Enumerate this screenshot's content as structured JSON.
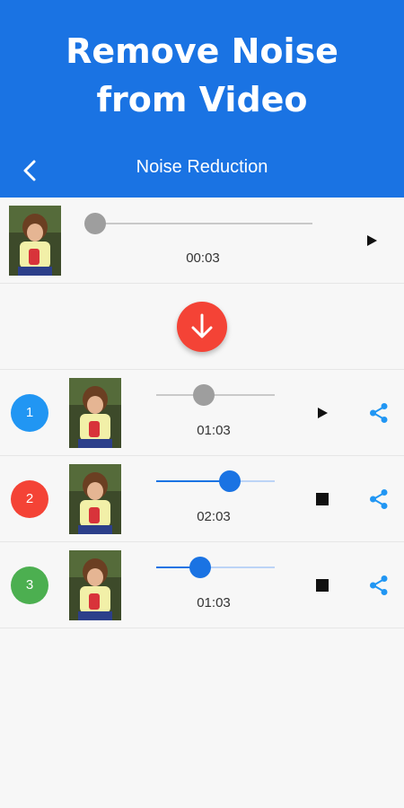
{
  "promo": {
    "line1": "Remove Noise",
    "line2": "from Video"
  },
  "toolbar": {
    "title": "Noise Reduction",
    "back_icon": "chevron-left-icon"
  },
  "colors": {
    "primary": "#1a73e3",
    "accent_red": "#f44336",
    "badge_blue": "#2196f3",
    "badge_red": "#f44336",
    "badge_green": "#4caf50"
  },
  "original": {
    "time": "00:03",
    "progress": 0.03,
    "control": "play-icon"
  },
  "download": {
    "icon": "arrow-down-icon"
  },
  "results": [
    {
      "number": "1",
      "time": "01:03",
      "progress": 0.4,
      "control": "play-icon",
      "share_icon": "share-icon"
    },
    {
      "number": "2",
      "time": "02:03",
      "progress": 0.62,
      "control": "stop-icon",
      "share_icon": "share-icon"
    },
    {
      "number": "3",
      "time": "01:03",
      "progress": 0.37,
      "control": "stop-icon",
      "share_icon": "share-icon"
    }
  ]
}
